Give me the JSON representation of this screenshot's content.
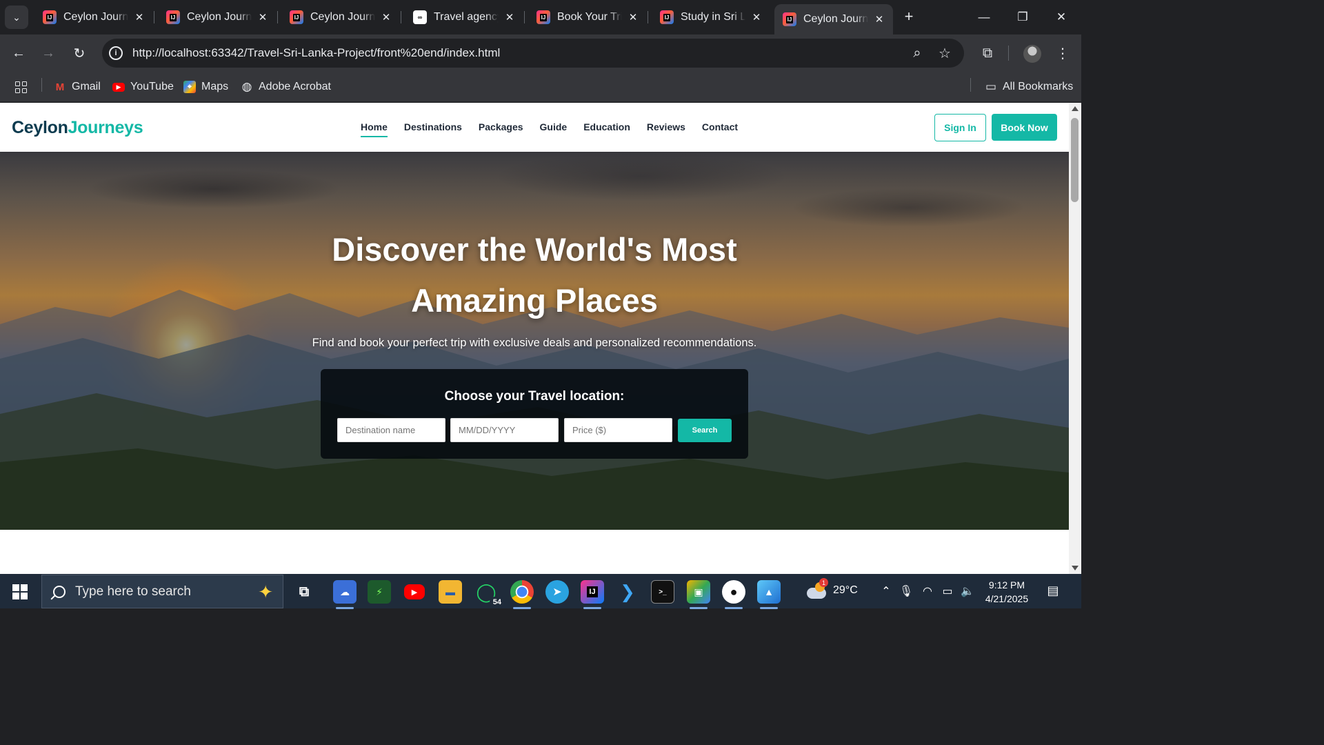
{
  "browser": {
    "tabs": [
      {
        "title": "Ceylon Journeys",
        "favicon": "intellij-icon",
        "active": false
      },
      {
        "title": "Ceylon Journeys",
        "favicon": "intellij-icon",
        "active": false
      },
      {
        "title": "Ceylon Journeys",
        "favicon": "intellij-icon",
        "active": false
      },
      {
        "title": "Travel agency",
        "favicon": "web-icon",
        "active": false
      },
      {
        "title": "Book Your Trip",
        "favicon": "intellij-icon",
        "active": false
      },
      {
        "title": "Study in Sri Lanka",
        "favicon": "intellij-icon",
        "active": false
      },
      {
        "title": "Ceylon Journeys",
        "favicon": "intellij-icon",
        "active": true
      }
    ],
    "url": "http://localhost:63342/Travel-Sri-Lanka-Project/front%20end/index.html",
    "bookmarks": [
      {
        "label": "Gmail",
        "icon": "gmail-icon"
      },
      {
        "label": "YouTube",
        "icon": "youtube-icon"
      },
      {
        "label": "Maps",
        "icon": "maps-icon"
      },
      {
        "label": "Adobe Acrobat",
        "icon": "globe-icon"
      }
    ],
    "all_bookmarks": "All Bookmarks"
  },
  "site": {
    "logo": {
      "part1": "Ceylon",
      "part2": "Journeys"
    },
    "nav": [
      "Home",
      "Destinations",
      "Packages",
      "Guide",
      "Education",
      "Reviews",
      "Contact"
    ],
    "active_nav": "Home",
    "sign_in": "Sign In",
    "book_now": "Book Now",
    "hero": {
      "title_line1": "Discover the World's Most",
      "title_line2": "Amazing Places",
      "subtitle": "Find and book your perfect trip with exclusive deals and personalized recommendations."
    },
    "search": {
      "title": "Choose your Travel location:",
      "destination_placeholder": "Destination name",
      "date_placeholder": "MM/DD/YYYY",
      "price_placeholder": "Price ($)",
      "button": "Search"
    }
  },
  "colors": {
    "accent": "#14b8a6",
    "logo_dark": "#0d3b4f",
    "browser_bg": "#202124",
    "taskbar_bg": "#1f2b3a"
  },
  "taskbar": {
    "search_placeholder": "Type here to search",
    "apps": [
      "task-view-icon",
      "cloud-app-icon",
      "terminal-app-icon",
      "youtube-app-icon",
      "file-explorer-icon",
      "whatsapp-icon",
      "chrome-icon",
      "telegram-icon",
      "intellij-icon",
      "vscode-icon",
      "cmd-icon",
      "files-app-icon",
      "github-icon",
      "photos-icon"
    ],
    "whatsapp_badge": "54",
    "weather": {
      "temp": "29°C",
      "badge": "1"
    },
    "time": "9:12 PM",
    "date": "4/21/2025"
  }
}
